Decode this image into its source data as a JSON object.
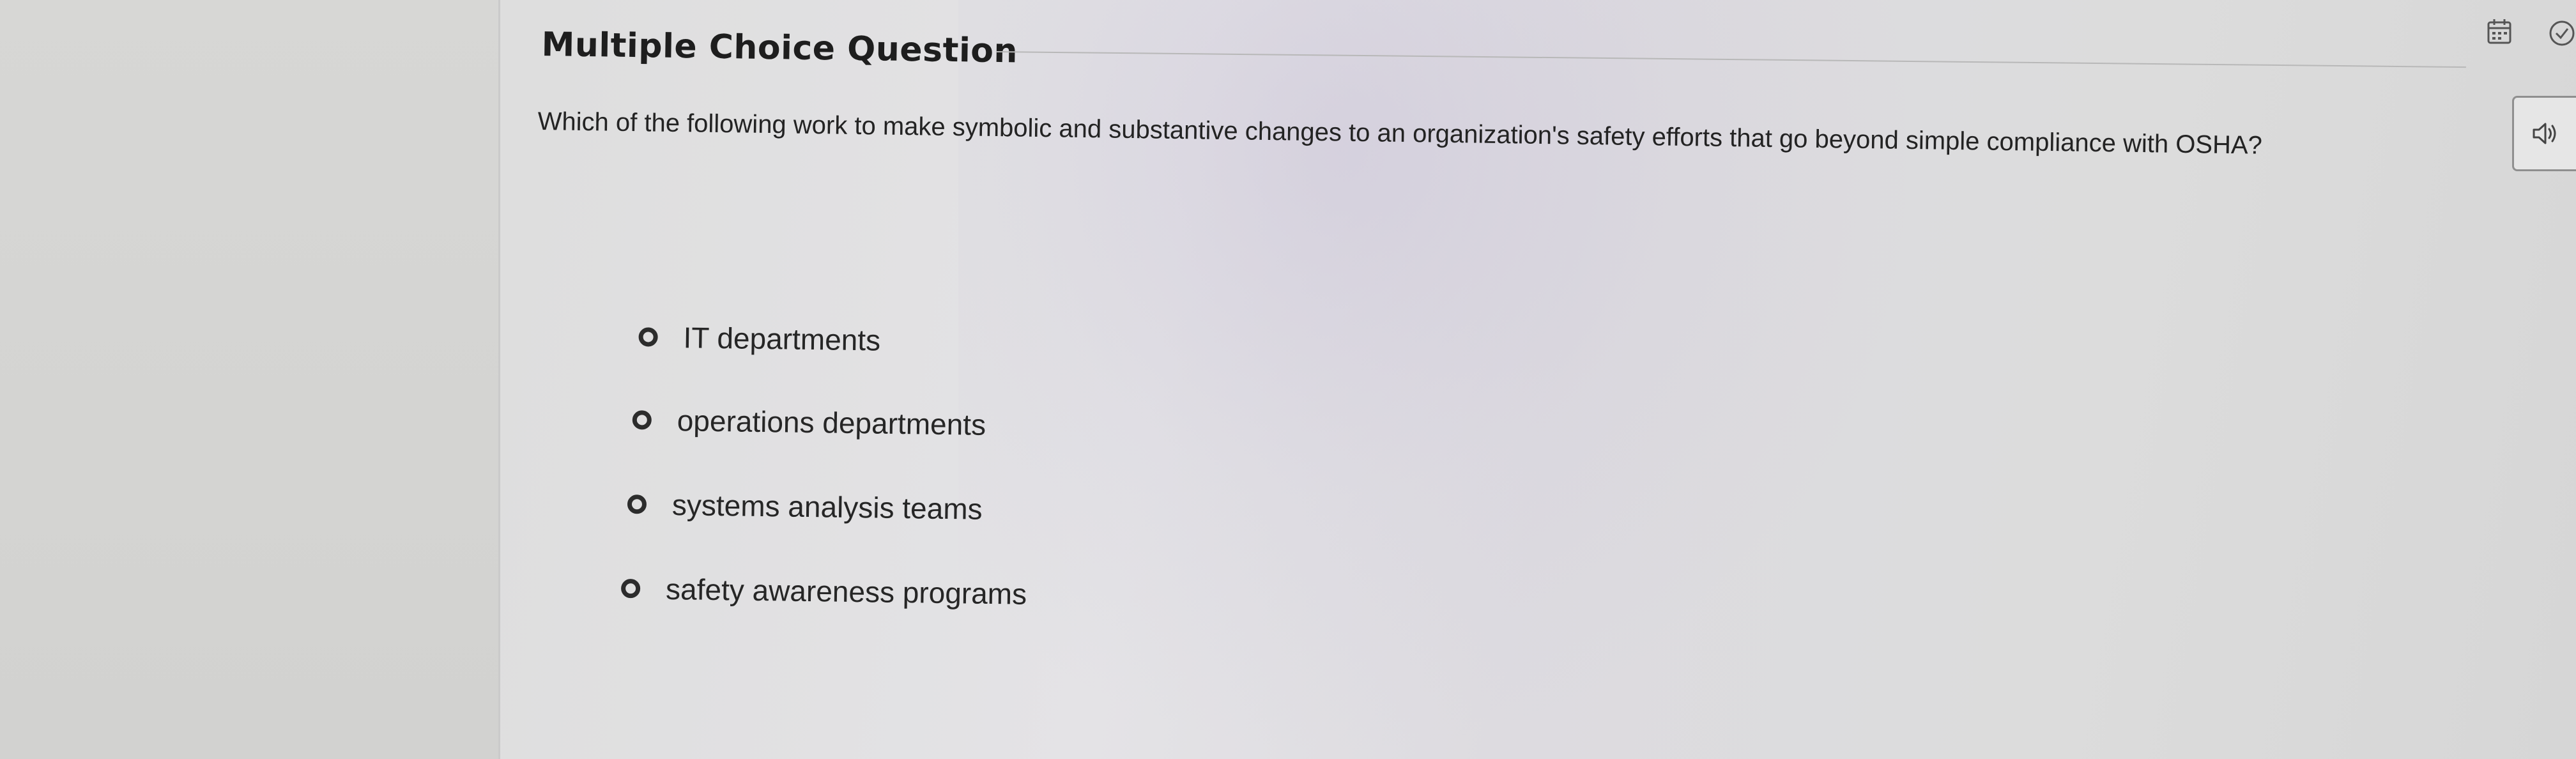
{
  "question": {
    "type_label": "Multiple Choice Question",
    "text": "Which of the following work to make symbolic and substantive changes to an organization's safety efforts that go beyond simple compliance with OSHA?"
  },
  "options": [
    {
      "label": "IT departments",
      "selected": false
    },
    {
      "label": "operations departments",
      "selected": false
    },
    {
      "label": "systems analysis teams",
      "selected": false
    },
    {
      "label": "safety awareness programs",
      "selected": false
    }
  ],
  "toolbar": {
    "calendar_icon": "calendar-icon",
    "check_icon": "check-circle-icon",
    "audio_icon": "speaker-icon"
  },
  "colors": {
    "text": "#232323",
    "radio_border": "#2c2c2c"
  }
}
